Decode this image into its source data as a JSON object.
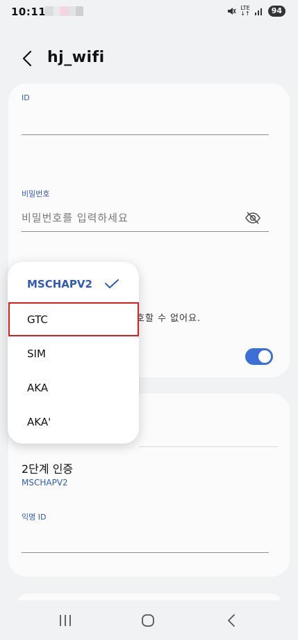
{
  "status": {
    "time": "10:11",
    "network": "LTE",
    "battery": "94"
  },
  "header": {
    "title": "hj_wifi"
  },
  "form": {
    "id_label": "ID",
    "id_value": "",
    "password_label": "비밀번호",
    "password_placeholder": "비밀번호를 입력하세요",
    "hint_partial": "호할 수 없어요.",
    "second_auth_label": "2단계 인증",
    "second_auth_value": "MSCHAPV2",
    "anonymous_id_label": "익명 ID",
    "anonymous_id_value": ""
  },
  "dropdown": {
    "options": [
      "MSCHAPV2",
      "GTC",
      "SIM",
      "AKA",
      "AKA'"
    ],
    "selected": "MSCHAPV2",
    "highlighted": "GTC"
  },
  "toggle": {
    "checked": true
  },
  "colors": {
    "accent": "#2f5bb7",
    "toggle": "#3e6fd9",
    "highlight": "#e01b1b"
  }
}
